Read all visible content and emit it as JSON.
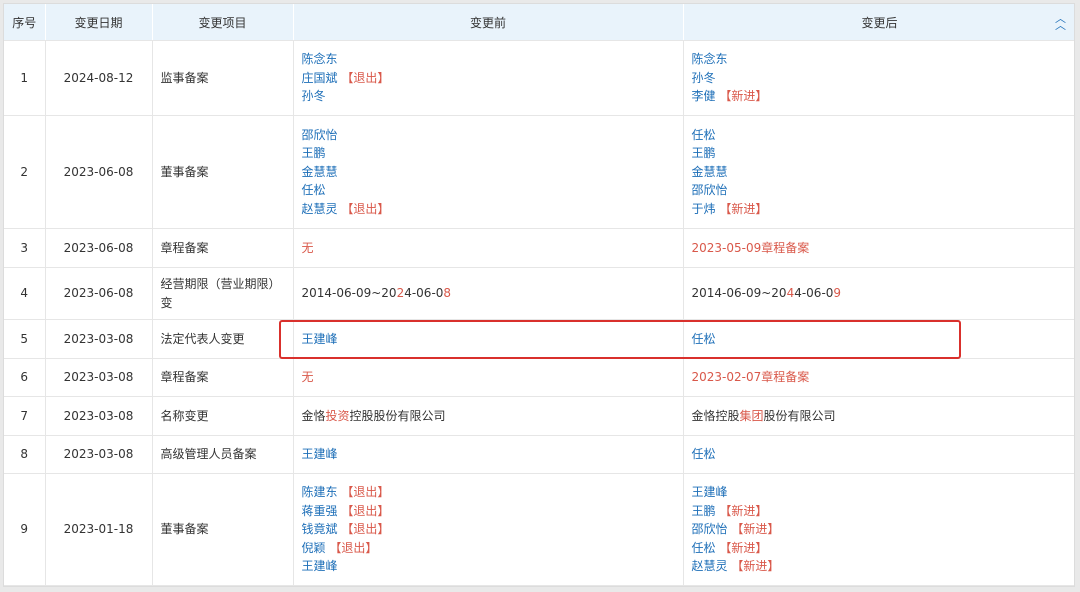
{
  "headers": [
    "序号",
    "变更日期",
    "变更项目",
    "变更前",
    "变更后"
  ],
  "rows": [
    {
      "index": "1",
      "date": "2024-08-12",
      "item": [
        "监事备案"
      ],
      "heights": 75,
      "before": [
        [
          {
            "t": "陈念东",
            "c": "blue"
          }
        ],
        [
          {
            "t": "庄国斌",
            "c": "blue"
          },
          {
            "t": " 【退出】",
            "c": "red"
          }
        ],
        [
          {
            "t": "孙冬",
            "c": "blue"
          }
        ]
      ],
      "after": [
        [
          {
            "t": "陈念东",
            "c": "blue"
          }
        ],
        [
          {
            "t": "孙冬",
            "c": "blue"
          }
        ],
        [
          {
            "t": "李健",
            "c": "blue"
          },
          {
            "t": " 【新进】",
            "c": "red"
          }
        ]
      ]
    },
    {
      "index": "2",
      "date": "2023-06-08",
      "item": [
        "董事备案"
      ],
      "heights": 113,
      "before": [
        [
          {
            "t": "邵欣怡",
            "c": "blue"
          }
        ],
        [
          {
            "t": "王鹏",
            "c": "blue"
          }
        ],
        [
          {
            "t": "金慧慧",
            "c": "blue"
          }
        ],
        [
          {
            "t": "任松",
            "c": "blue"
          }
        ],
        [
          {
            "t": "赵慧灵",
            "c": "blue"
          },
          {
            "t": " 【退出】",
            "c": "red"
          }
        ]
      ],
      "after": [
        [
          {
            "t": "任松",
            "c": "blue"
          }
        ],
        [
          {
            "t": "王鹏",
            "c": "blue"
          }
        ],
        [
          {
            "t": "金慧慧",
            "c": "blue"
          }
        ],
        [
          {
            "t": "邵欣怡",
            "c": "blue"
          }
        ],
        [
          {
            "t": "于炜",
            "c": "blue"
          },
          {
            "t": " 【新进】",
            "c": "red"
          }
        ]
      ]
    },
    {
      "index": "3",
      "date": "2023-06-08",
      "item": [
        "章程备案"
      ],
      "heights": 39,
      "before": [
        [
          {
            "t": "无",
            "c": "red"
          }
        ]
      ],
      "after": [
        [
          {
            "t": "2023-05-09章程备案",
            "c": "red"
          }
        ]
      ]
    },
    {
      "index": "4",
      "date": "2023-06-08",
      "item": [
        "经营期限（营业期限）",
        "变"
      ],
      "heights": 52,
      "before": [
        [
          {
            "t": "2014-06-09~20",
            "c": ""
          },
          {
            "t": "2",
            "c": "red"
          },
          {
            "t": "4-06-0",
            "c": ""
          },
          {
            "t": "8",
            "c": "red"
          }
        ]
      ],
      "after": [
        [
          {
            "t": "2014-06-09~20",
            "c": ""
          },
          {
            "t": "4",
            "c": "red"
          },
          {
            "t": "4-06-0",
            "c": ""
          },
          {
            "t": "9",
            "c": "red"
          }
        ]
      ]
    },
    {
      "index": "5",
      "date": "2023-03-08",
      "item": [
        "法定代表人变更"
      ],
      "heights": 39,
      "before": [
        [
          {
            "t": "王建峰",
            "c": "blue"
          }
        ]
      ],
      "after": [
        [
          {
            "t": "任松",
            "c": "blue"
          }
        ]
      ]
    },
    {
      "index": "6",
      "date": "2023-03-08",
      "item": [
        "章程备案"
      ],
      "heights": 38,
      "before": [
        [
          {
            "t": "无",
            "c": "red"
          }
        ]
      ],
      "after": [
        [
          {
            "t": "2023-02-07章程备案",
            "c": "red"
          }
        ]
      ]
    },
    {
      "index": "7",
      "date": "2023-03-08",
      "item": [
        "名称变更"
      ],
      "heights": 39,
      "before": [
        [
          {
            "t": "金恪",
            "c": ""
          },
          {
            "t": "投资",
            "c": "red"
          },
          {
            "t": "控股股份有限公司",
            "c": ""
          }
        ]
      ],
      "after": [
        [
          {
            "t": "金恪控股",
            "c": ""
          },
          {
            "t": "集团",
            "c": "red"
          },
          {
            "t": "股份有限公司",
            "c": ""
          }
        ]
      ]
    },
    {
      "index": "8",
      "date": "2023-03-08",
      "item": [
        "高级管理人员备案"
      ],
      "heights": 38,
      "before": [
        [
          {
            "t": "王建峰",
            "c": "blue"
          }
        ]
      ],
      "after": [
        [
          {
            "t": "任松",
            "c": "blue"
          }
        ]
      ]
    },
    {
      "index": "9",
      "date": "2023-01-18",
      "item": [
        "董事备案"
      ],
      "heights": 112,
      "before": [
        [
          {
            "t": "陈建东",
            "c": "blue"
          },
          {
            "t": " 【退出】",
            "c": "red"
          }
        ],
        [
          {
            "t": "蒋重强",
            "c": "blue"
          },
          {
            "t": " 【退出】",
            "c": "red"
          }
        ],
        [
          {
            "t": "钱竟斌",
            "c": "blue"
          },
          {
            "t": " 【退出】",
            "c": "red"
          }
        ],
        [
          {
            "t": "倪颖",
            "c": "blue"
          },
          {
            "t": " 【退出】",
            "c": "red"
          }
        ],
        [
          {
            "t": "王建峰",
            "c": "blue"
          }
        ]
      ],
      "after": [
        [
          {
            "t": "王建峰",
            "c": "blue"
          }
        ],
        [
          {
            "t": "王鹏",
            "c": "blue"
          },
          {
            "t": " 【新进】",
            "c": "red"
          }
        ],
        [
          {
            "t": "邵欣怡",
            "c": "blue"
          },
          {
            "t": " 【新进】",
            "c": "red"
          }
        ],
        [
          {
            "t": "任松",
            "c": "blue"
          },
          {
            "t": " 【新进】",
            "c": "red"
          }
        ],
        [
          {
            "t": "赵慧灵",
            "c": "blue"
          },
          {
            "t": " 【新进】",
            "c": "red"
          }
        ]
      ]
    }
  ],
  "colors": {
    "link": "#1e6fb8",
    "highlight": "#d9584a",
    "header_bg": "#e9f3fb",
    "box": "#d9302c"
  },
  "icons": {
    "collapse": "chevron-double-up-icon"
  }
}
